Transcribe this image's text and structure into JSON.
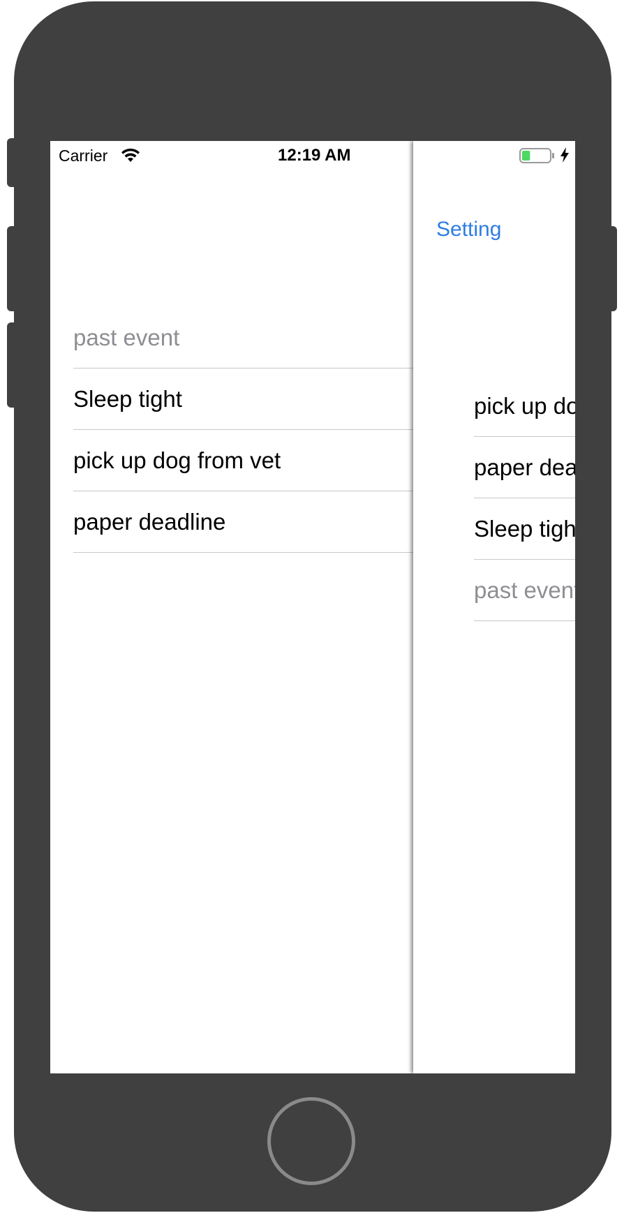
{
  "status_bar": {
    "carrier": "Carrier",
    "time": "12:19 AM",
    "wifi_icon": "wifi-icon",
    "battery_icon": "battery-icon",
    "charging_icon": "bolt-icon",
    "battery_level": 0.3,
    "battery_color": "#4cd964"
  },
  "menu": {
    "items": [
      {
        "label": "past event",
        "style": "dimmed"
      },
      {
        "label": "Sleep tight",
        "style": "normal"
      },
      {
        "label": "pick up dog from vet",
        "style": "normal"
      },
      {
        "label": "paper deadline",
        "style": "normal"
      }
    ]
  },
  "main": {
    "setting_label": "Setting",
    "accent_color": "#2f7de1",
    "items": [
      {
        "label": "pick up dog from vet",
        "style": "normal"
      },
      {
        "label": "paper deadline",
        "style": "normal"
      },
      {
        "label": "Sleep tight",
        "style": "normal"
      },
      {
        "label": "past event",
        "style": "dimmed"
      }
    ]
  },
  "device": {
    "frame_color": "#404040",
    "home_button_icon": "home-button"
  }
}
